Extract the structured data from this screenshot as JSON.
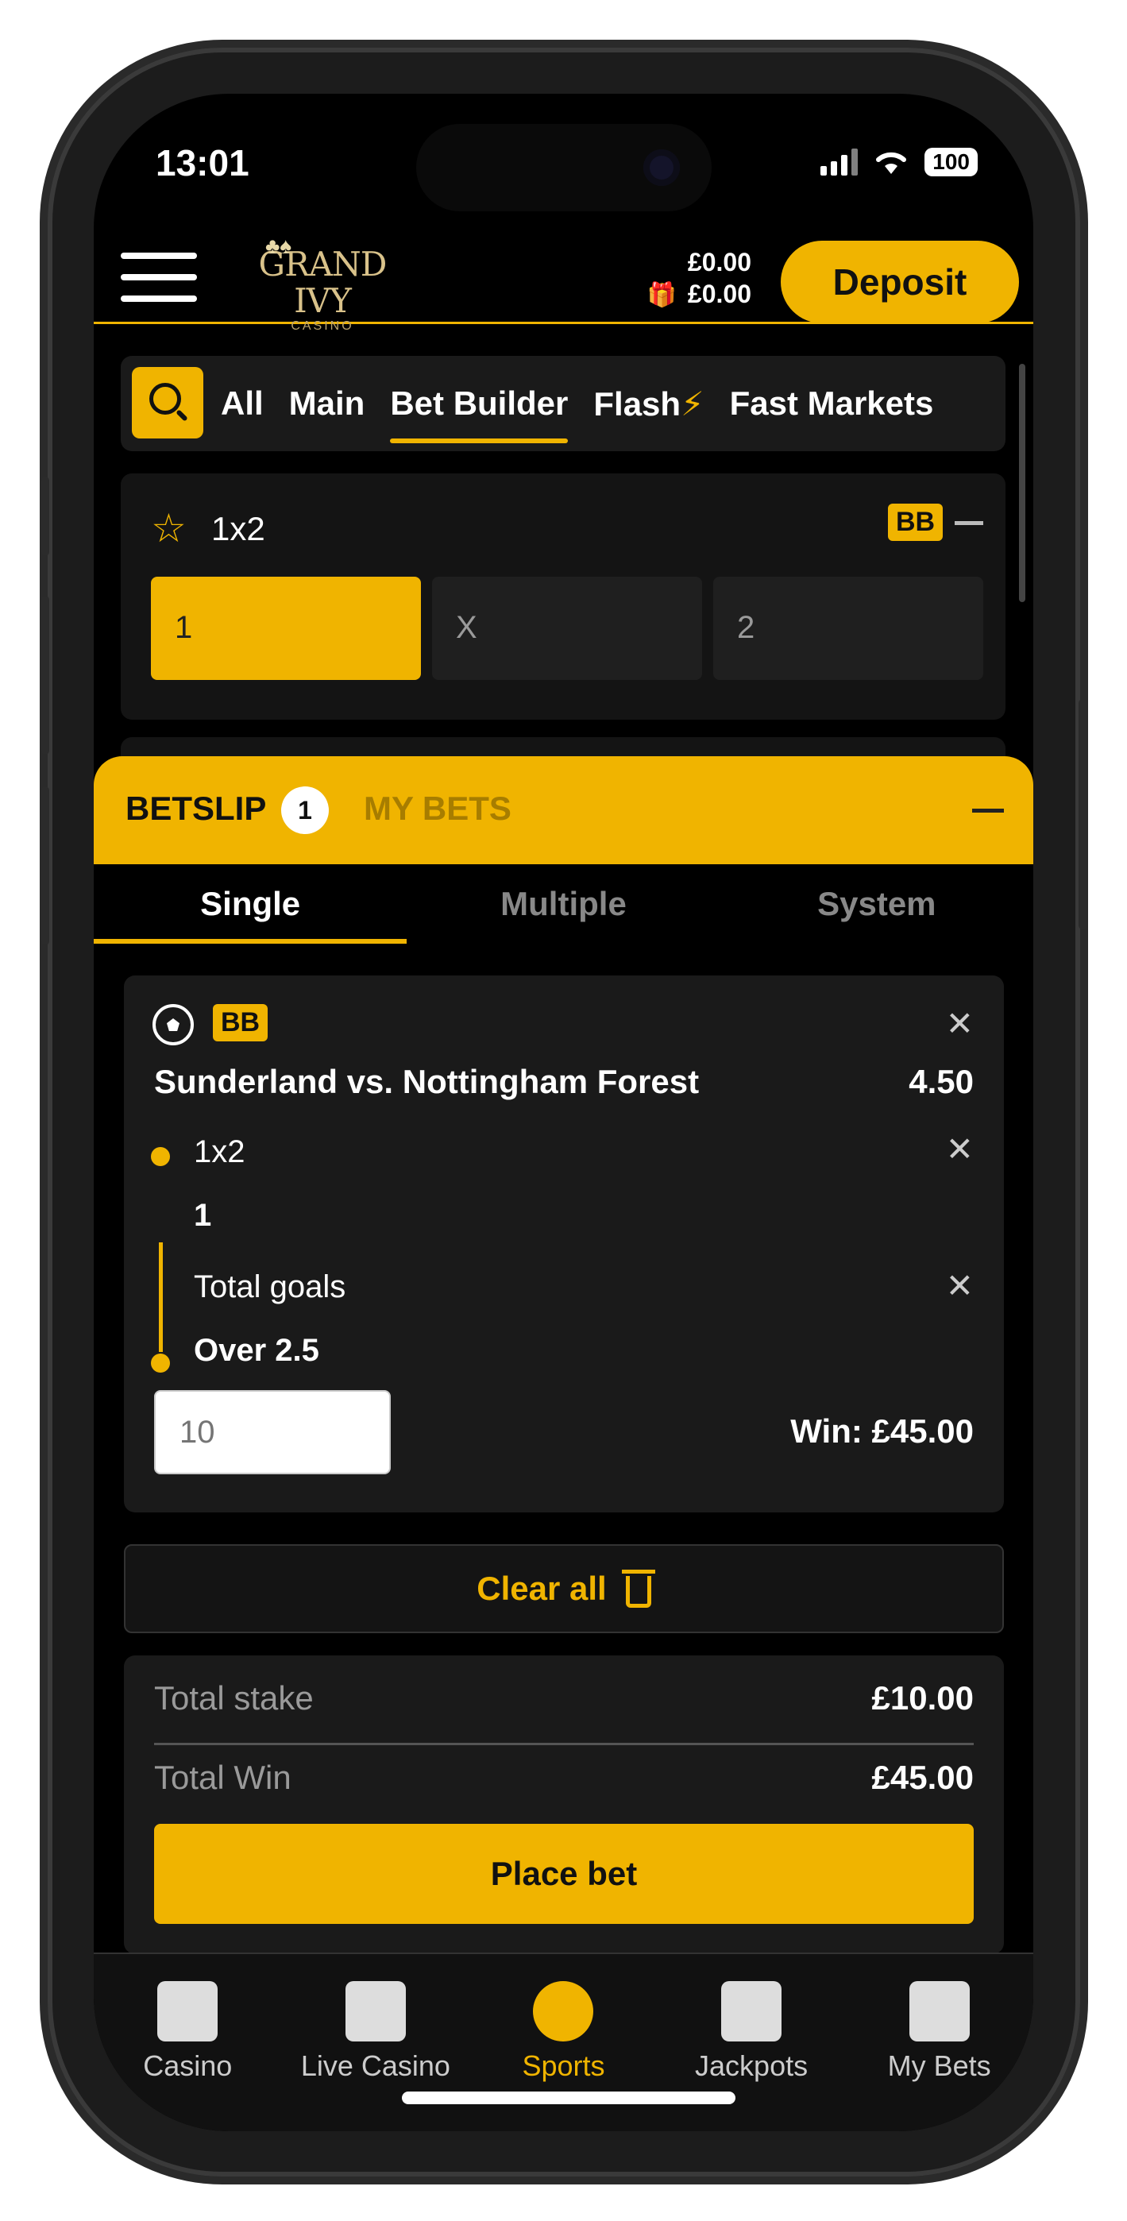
{
  "status_bar": {
    "time": "13:01",
    "battery": "100"
  },
  "header": {
    "logo_name": "GRAND IVY",
    "logo_sub": "CASINO",
    "balance_cash": "£0.00",
    "balance_bonus": "£0.00",
    "deposit_label": "Deposit"
  },
  "tabs": [
    "All",
    "Main",
    "Bet Builder",
    "Flash",
    "Fast Markets"
  ],
  "active_tab": "Bet Builder",
  "market": {
    "title": "1x2",
    "badge": "BB",
    "odds": [
      {
        "label": "1",
        "selected": true
      },
      {
        "label": "X",
        "selected": false
      },
      {
        "label": "2",
        "selected": false
      }
    ]
  },
  "betslip": {
    "label": "BETSLIP",
    "count": "1",
    "my_bets": "MY BETS",
    "type_tabs": [
      "Single",
      "Multiple",
      "System"
    ],
    "active_type": "Single",
    "bet": {
      "badge": "BB",
      "event": "Sunderland vs. Nottingham Forest",
      "odds": "4.50",
      "legs": [
        {
          "market": "1x2",
          "pick": "1"
        },
        {
          "market": "Total goals",
          "pick": "Over 2.5"
        }
      ],
      "stake_placeholder": "10",
      "win": "Win: £45.00"
    },
    "clear_all": "Clear all",
    "total_stake_label": "Total stake",
    "total_stake": "£10.00",
    "total_win_label": "Total Win",
    "total_win": "£45.00",
    "place_bet": "Place bet"
  },
  "bottom_nav": [
    {
      "label": "Casino",
      "icon": "slot-machine-icon"
    },
    {
      "label": "Live Casino",
      "icon": "cards-icon"
    },
    {
      "label": "Sports",
      "icon": "football-icon"
    },
    {
      "label": "Jackpots",
      "icon": "diamond-icon"
    },
    {
      "label": "My Bets",
      "icon": "receipt-icon"
    }
  ],
  "active_nav": "Sports",
  "colors": {
    "accent": "#f0b400",
    "background": "#000000",
    "card": "#1a1a1a"
  }
}
